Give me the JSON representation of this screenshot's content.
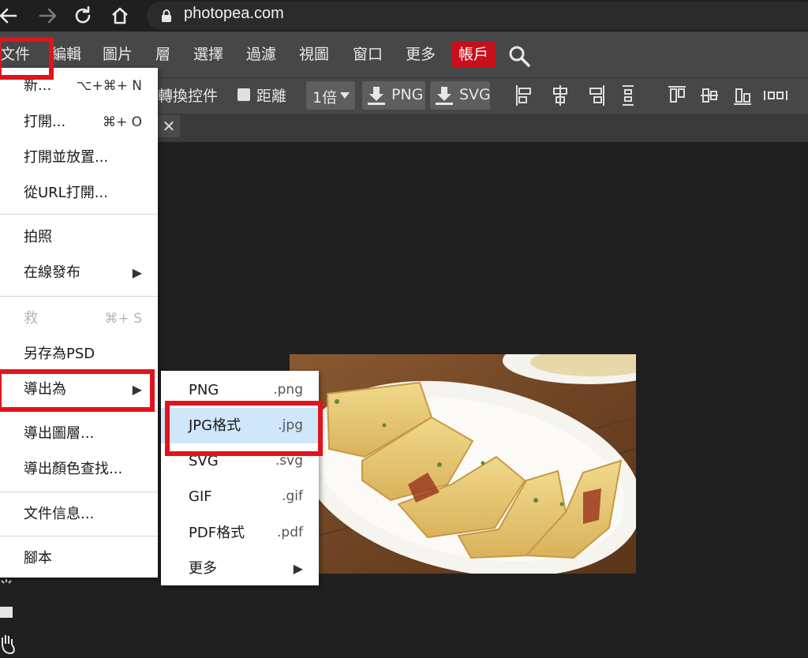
{
  "browser": {
    "back_icon": "back-arrow-icon",
    "forward_icon": "forward-arrow-icon",
    "reload_icon": "reload-icon",
    "home_icon": "home-icon",
    "url": "photopea.com"
  },
  "menubar": {
    "items": [
      "文件",
      "編輯",
      "圖片",
      "層",
      "選擇",
      "過濾",
      "視圖",
      "窗口",
      "更多"
    ],
    "account": "帳戶",
    "account_color": "#c7101c"
  },
  "toolbar": {
    "transform_controls": "轉換控件",
    "distance": "距離",
    "scale": "1倍",
    "png_button": "PNG",
    "svg_button": "SVG"
  },
  "file_menu": {
    "new": {
      "label": "新...",
      "shortcut": "⌥+⌘+ N"
    },
    "open": {
      "label": "打開...",
      "shortcut": "⌘+ O"
    },
    "open_place": {
      "label": "打開並放置..."
    },
    "open_url": {
      "label": "從URL打開..."
    },
    "photo": {
      "label": "拍照"
    },
    "publish": {
      "label": "在線發布"
    },
    "save": {
      "label": "救",
      "shortcut": "⌘+ S"
    },
    "save_psd": {
      "label": "另存為PSD"
    },
    "export_as": {
      "label": "導出為"
    },
    "export_layers": {
      "label": "導出圖層..."
    },
    "export_color_lookup": {
      "label": "導出顏色查找..."
    },
    "document_info": {
      "label": "文件信息..."
    },
    "script": {
      "label": "腳本"
    }
  },
  "export_submenu": {
    "items": [
      {
        "label": "PNG",
        "ext": ".png"
      },
      {
        "label": "JPG格式",
        "ext": ".jpg"
      },
      {
        "label": "SVG",
        "ext": ".svg"
      },
      {
        "label": "GIF",
        "ext": ".gif"
      },
      {
        "label": "PDF格式",
        "ext": ".pdf"
      },
      {
        "label": "更多",
        "ext": ""
      }
    ]
  },
  "highlight_color": "#e0141c"
}
